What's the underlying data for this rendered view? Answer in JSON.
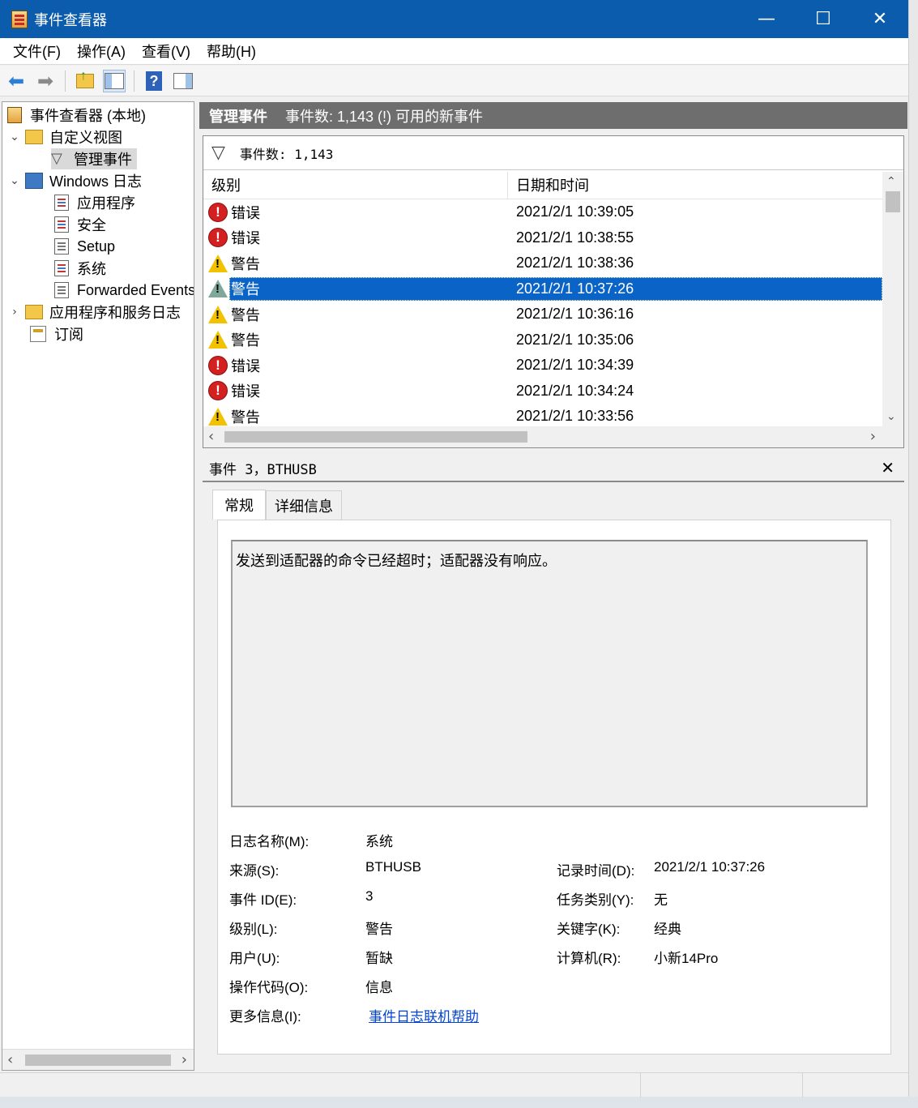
{
  "window": {
    "title": "事件查看器"
  },
  "window_controls": {
    "minimize": "—",
    "maximize": "☐",
    "close": "✕"
  },
  "menu": [
    "文件(F)",
    "操作(A)",
    "查看(V)",
    "帮助(H)"
  ],
  "tree": {
    "root": "事件查看器 (本地)",
    "custom_views": "自定义视图",
    "admin_events": "管理事件",
    "windows_logs": "Windows 日志",
    "application": "应用程序",
    "security": "安全",
    "setup": "Setup",
    "system": "系统",
    "forwarded": "Forwarded Events",
    "app_service_logs": "应用程序和服务日志",
    "subscriptions": "订阅"
  },
  "header": {
    "name": "管理事件",
    "summary": "事件数: 1,143 (!) 可用的新事件"
  },
  "filter": {
    "text": "事件数: 1,143"
  },
  "grid": {
    "col_level": "级别",
    "col_datetime": "日期和时间",
    "rows": [
      {
        "level": "错误",
        "kind": "error",
        "datetime": "2021/2/1 10:39:05"
      },
      {
        "level": "错误",
        "kind": "error",
        "datetime": "2021/2/1 10:38:55"
      },
      {
        "level": "警告",
        "kind": "warning",
        "datetime": "2021/2/1 10:38:36"
      },
      {
        "level": "警告",
        "kind": "warning",
        "datetime": "2021/2/1 10:37:26",
        "selected": true
      },
      {
        "level": "警告",
        "kind": "warning",
        "datetime": "2021/2/1 10:36:16"
      },
      {
        "level": "警告",
        "kind": "warning",
        "datetime": "2021/2/1 10:35:06"
      },
      {
        "level": "错误",
        "kind": "error",
        "datetime": "2021/2/1 10:34:39"
      },
      {
        "level": "错误",
        "kind": "error",
        "datetime": "2021/2/1 10:34:24"
      },
      {
        "level": "警告",
        "kind": "warning",
        "datetime": "2021/2/1 10:33:56"
      }
    ]
  },
  "detail": {
    "title": "事件 3，BTHUSB",
    "tabs": [
      "常规",
      "详细信息"
    ],
    "description": "发送到适配器的命令已经超时；适配器没有响应。",
    "props": {
      "log_name_label": "日志名称(M):",
      "log_name": "系统",
      "source_label": "来源(S):",
      "source": "BTHUSB",
      "logged_label": "记录时间(D):",
      "logged": "2021/2/1 10:37:26",
      "event_id_label": "事件 ID(E):",
      "event_id": "3",
      "task_label": "任务类别(Y):",
      "task": "无",
      "level_label": "级别(L):",
      "level": "警告",
      "keywords_label": "关键字(K):",
      "keywords": "经典",
      "user_label": "用户(U):",
      "user": "暂缺",
      "computer_label": "计算机(R):",
      "computer": "小新14Pro",
      "opcode_label": "操作代码(O):",
      "opcode": "信息",
      "more_info_label": "更多信息(I):",
      "more_info": "事件日志联机帮助"
    }
  }
}
